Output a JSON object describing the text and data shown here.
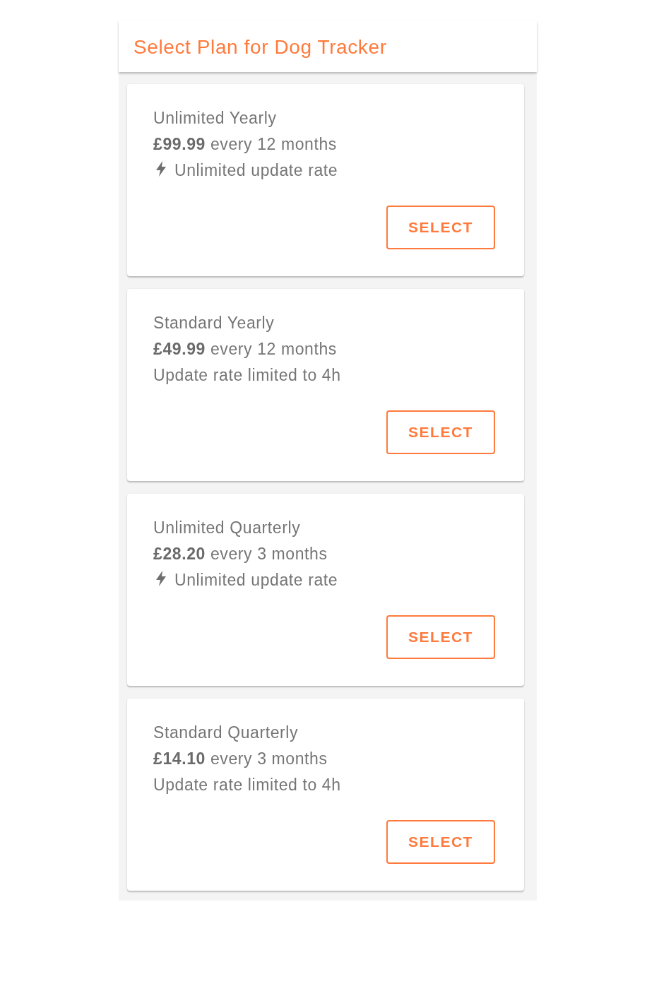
{
  "header": {
    "title": "Select Plan for Dog Tracker"
  },
  "plans": [
    {
      "name": "Unlimited Yearly",
      "price": "**£99.99** every 12 months",
      "feature": {
        "kind": "bolt",
        "text": "Unlimited update rate"
      },
      "button": "SELECT"
    },
    {
      "name": "Standard Yearly",
      "price": "**£49.99** every 12 months",
      "feature": {
        "kind": "plain",
        "text": "Update rate limited to 4h"
      },
      "button": "SELECT"
    },
    {
      "name": "Unlimited Quarterly",
      "price": "**£28.20** every 3 months",
      "feature": {
        "kind": "bolt",
        "text": "Unlimited update rate"
      },
      "button": "SELECT"
    },
    {
      "name": "Standard Quarterly",
      "price": "**£14.10** every 3 months",
      "feature": {
        "kind": "plain",
        "text": "Update rate limited to 4h"
      },
      "button": "SELECT"
    }
  ]
}
